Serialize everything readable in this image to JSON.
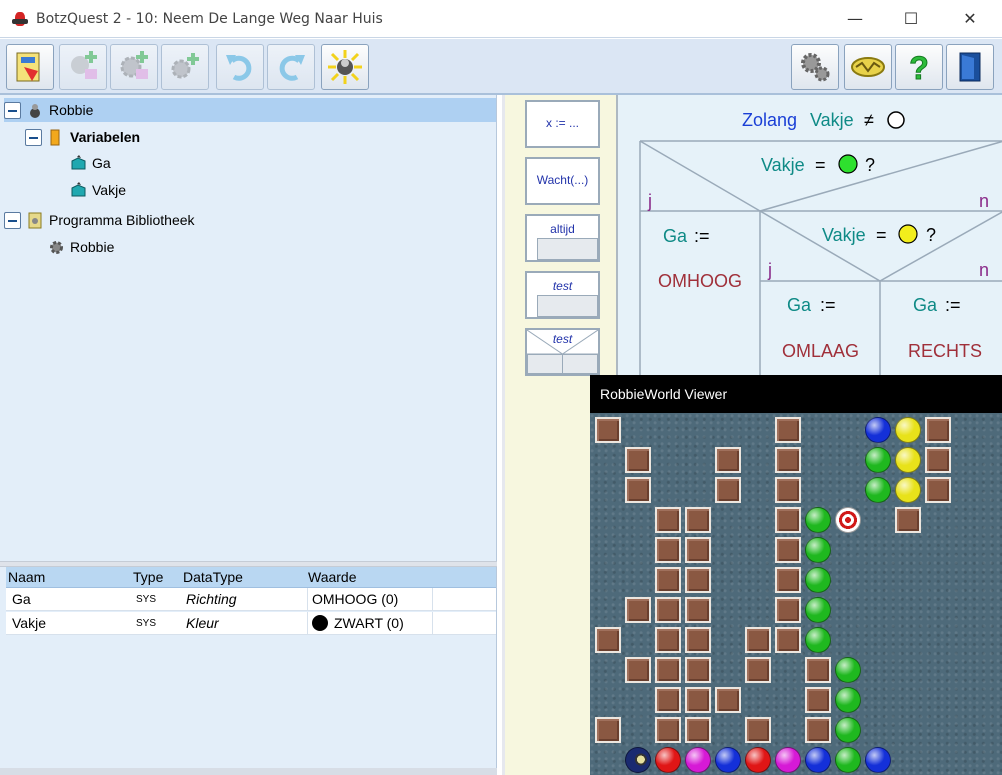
{
  "window": {
    "title": "BotzQuest 2 - 10: Neem De Lange Weg Naar Huis",
    "controls": {
      "minimize": "—",
      "maximize": "☐",
      "close": "✕"
    }
  },
  "toolbar": {
    "left": [
      {
        "name": "open-project-button",
        "icon": "book-icon",
        "enabled": true
      },
      {
        "name": "add-robot-button",
        "icon": "robot-plus-icon",
        "enabled": false
      },
      {
        "name": "add-gear-button",
        "icon": "gear-plus-icon",
        "enabled": false
      },
      {
        "name": "add-subroutine-button",
        "icon": "small-gear-plus-icon",
        "enabled": false
      },
      {
        "name": "undo-button",
        "icon": "undo-icon",
        "enabled": false
      },
      {
        "name": "redo-button",
        "icon": "redo-icon",
        "enabled": false
      },
      {
        "name": "run-robot-button",
        "icon": "robot-shining-icon",
        "enabled": true
      }
    ],
    "right": [
      {
        "name": "settings-button",
        "icon": "gears-icon"
      },
      {
        "name": "world-button",
        "icon": "gold-robot-icon"
      },
      {
        "name": "help-button",
        "icon": "question-icon"
      },
      {
        "name": "exit-button",
        "icon": "door-icon"
      }
    ]
  },
  "tree": {
    "root_label": "Robbie",
    "variables_label": "Variabelen",
    "variable_items": [
      "Ga",
      "Vakje"
    ],
    "library_label": "Programma Bibliotheek",
    "library_items": [
      "Robbie"
    ]
  },
  "variables_table": {
    "headers": [
      "Naam",
      "Type",
      "DataType",
      "Waarde"
    ],
    "rows": [
      {
        "naam": "Ga",
        "type": "SYS",
        "datatype": "Richting",
        "waarde": "OMHOOG (0)"
      },
      {
        "naam": "Vakje",
        "type": "SYS",
        "datatype": "Kleur",
        "waarde": "ZWART (0)"
      }
    ]
  },
  "palette": {
    "assign": "x := ...",
    "wait": "Wacht(...)",
    "always": "altijd",
    "test": "test",
    "test_branch": "test"
  },
  "program": {
    "loop_keyword": "Zolang",
    "loop_variable": "Vakje",
    "loop_operator": "≠",
    "loop_color": "#ffffff",
    "if1_variable": "Vakje",
    "if1_operator": "=",
    "if1_color": "#2ee02e",
    "if1_question": "?",
    "yes_label": "j",
    "no_label": "n",
    "assign1_variable": "Ga",
    "assign1_operator": ":=",
    "assign1_value": "OMHOOG",
    "if2_variable": "Vakje",
    "if2_operator": "=",
    "if2_color": "#f2ee1c",
    "if2_question": "?",
    "assign2_variable": "Ga",
    "assign2_operator": ":=",
    "assign2_value": "OMLAAG",
    "assign3_variable": "Ga",
    "assign3_operator": ":=",
    "assign3_value": "RECHTS"
  },
  "viewer": {
    "title": "RobbieWorld Viewer",
    "legend": {
      "B": "box",
      "g": "green ball",
      "y": "yellow ball",
      "b": "blue ball",
      "r": "red ball",
      "m": "magenta ball",
      "t": "target",
      "R": "robot"
    },
    "grid": [
      "B.....B..byB",
      ".B..B.B..gyB",
      ".B..B.B..gyB",
      "..BB..Bgt B",
      "..BB..Bg....",
      "..BB..Bg....",
      ".BBB..Bg....",
      "B.BB.BBg....",
      ".BBB.B.Bg...",
      "..BBB..Bg...",
      "B.BB.B.Bg...",
      ".Rrmbrmbgb.."
    ]
  }
}
